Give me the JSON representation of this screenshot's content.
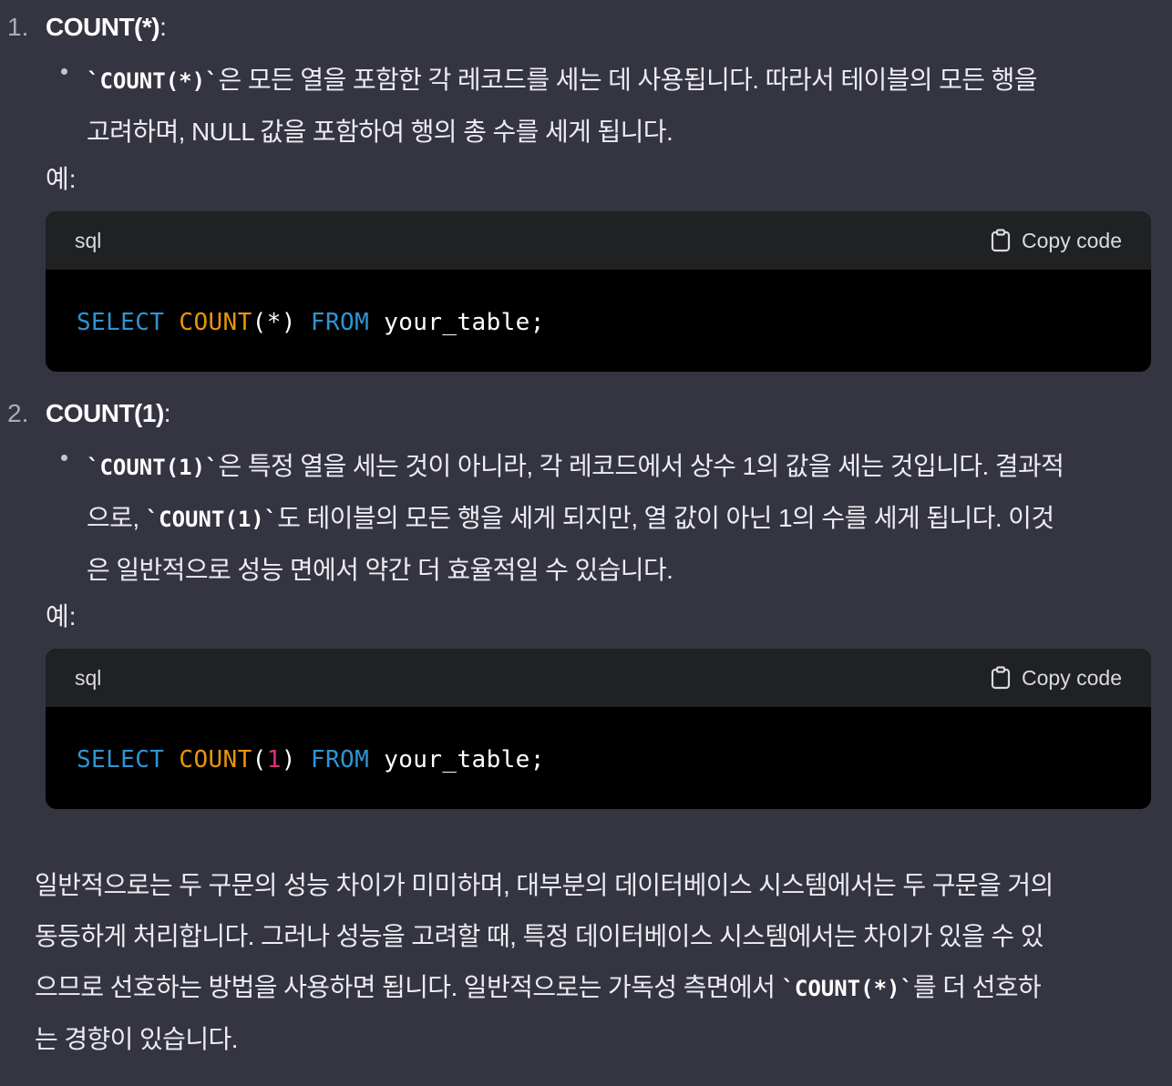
{
  "items": [
    {
      "number": "1.",
      "title": "COUNT(*)",
      "title_suffix": ":",
      "bullet": {
        "code": "`COUNT(*)`",
        "line1": "은 모든 열을 포함한 각 레코드를 세는 데 사용됩니다. 따라서 테이블의 모든 행을",
        "line2": "고려하며, NULL 값을 포함하여 행의 총 수를 세게 됩니다."
      },
      "example_label": "예:",
      "code_block": {
        "language": "sql",
        "copy_label": "Copy code",
        "tokens": {
          "select": "SELECT",
          "func": "COUNT",
          "open": "(",
          "arg": "*",
          "close": ")",
          "from": "FROM",
          "rest": "your_table;"
        }
      }
    },
    {
      "number": "2.",
      "title": "COUNT(1)",
      "title_suffix": ":",
      "bullet": {
        "code": "`COUNT(1)`",
        "line1": "은 특정 열을 세는 것이 아니라, 각 레코드에서 상수 1의 값을 세는 것입니다. 결과적",
        "line2_pre": "으로, ",
        "line2_code": "`COUNT(1)`",
        "line2_post": "도 테이블의 모든 행을 세게 되지만, 열 값이 아닌 1의 수를 세게 됩니다. 이것",
        "line3": "은 일반적으로 성능 면에서 약간 더 효율적일 수 있습니다."
      },
      "example_label": "예:",
      "code_block": {
        "language": "sql",
        "copy_label": "Copy code",
        "tokens": {
          "select": "SELECT",
          "func": "COUNT",
          "open": "(",
          "arg": "1",
          "close": ")",
          "from": "FROM",
          "rest": "your_table;"
        }
      }
    }
  ],
  "summary": {
    "line1": "일반적으로는 두 구문의 성능 차이가 미미하며, 대부분의 데이터베이스 시스템에서는 두 구문을 거의",
    "line2": "동등하게 처리합니다. 그러나 성능을 고려할 때, 특정 데이터베이스 시스템에서는 차이가 있을 수 있",
    "line3_pre": "으므로 선호하는 방법을 사용하면 됩니다. 일반적으로는 가독성 측면에서 ",
    "line3_code": "`COUNT(*)`",
    "line3_post": "를 더 선호하",
    "line4": "는 경향이 있습니다."
  },
  "colors": {
    "background": "#343541",
    "code_header": "#202123",
    "code_body": "#000000",
    "keyword": "#2e95d3",
    "function": "#e9950c",
    "number": "#df3079"
  }
}
